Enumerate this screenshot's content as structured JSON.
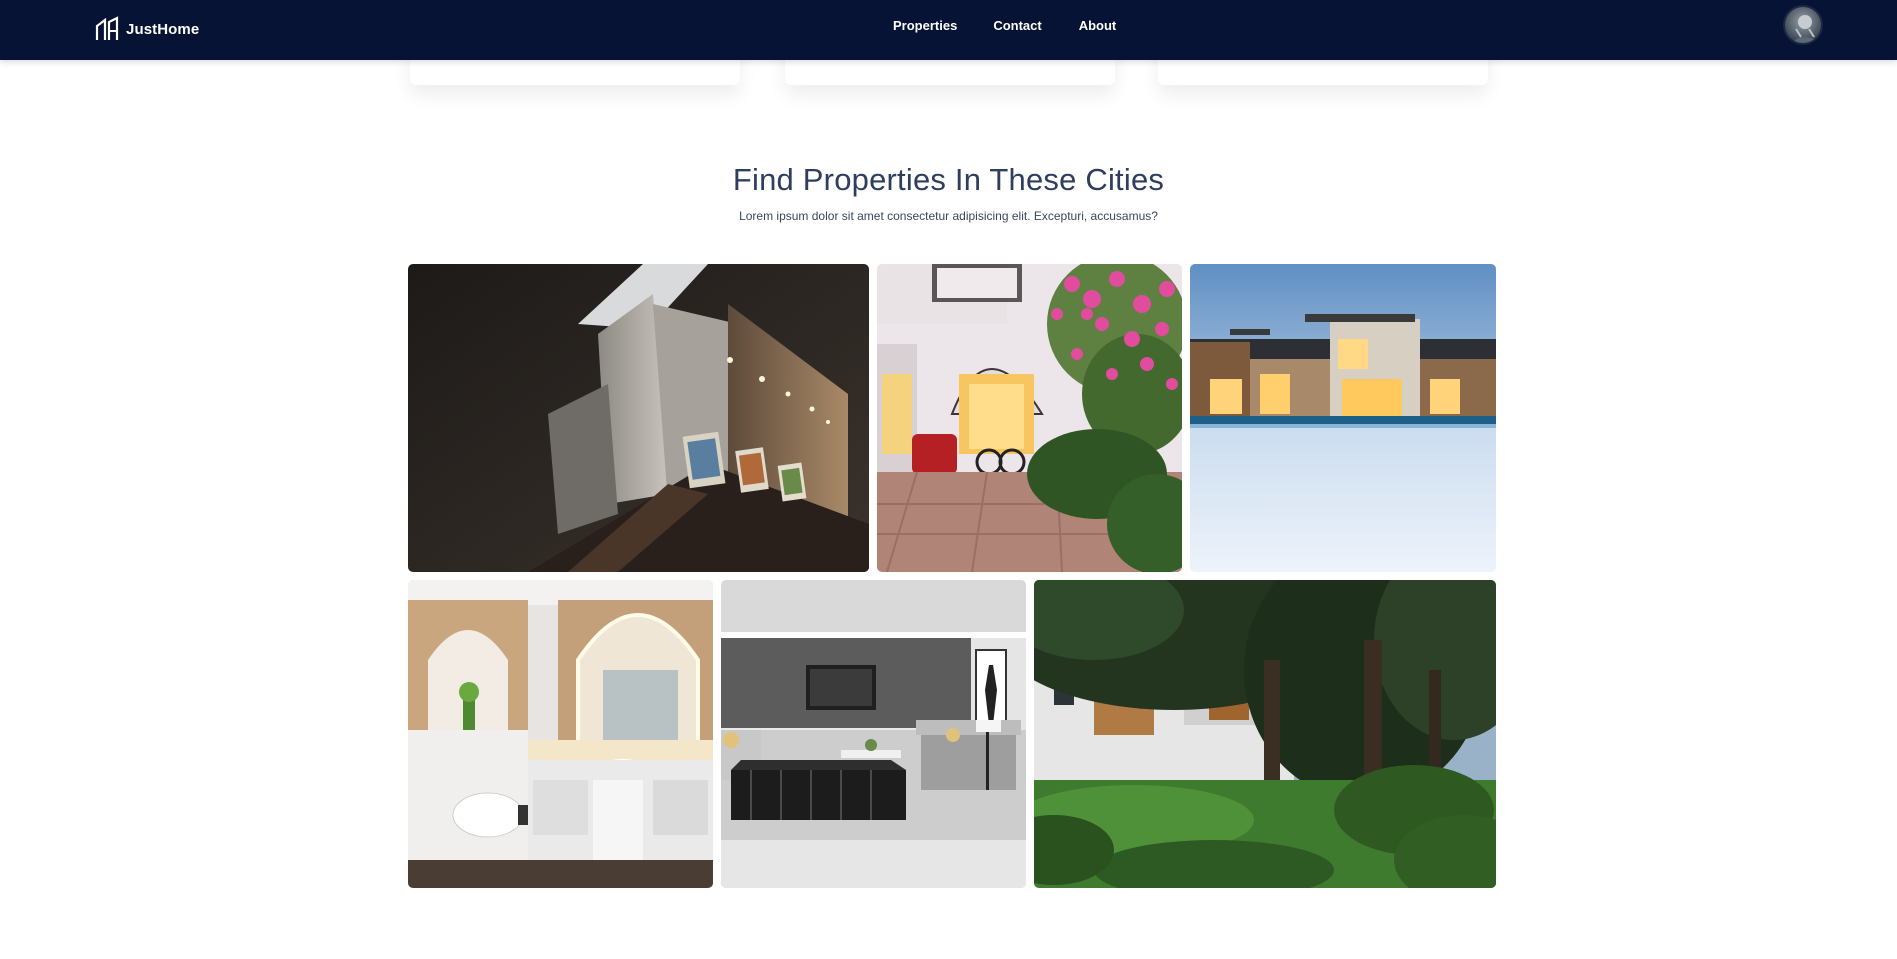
{
  "navbar": {
    "brand": "JustHome",
    "brand_icon": "house-outline-icon",
    "links": [
      "Properties",
      "Contact",
      "About"
    ],
    "avatar_icon": "user-avatar-icon"
  },
  "section": {
    "title": "Find Properties In These Cities",
    "subtitle": "Lorem ipsum dolor sit amet consectetur adipisicing elit. Excepturi, accusamus?"
  },
  "gallery": {
    "tiles": [
      {
        "name": "gallery-tile-gallery-interior"
      },
      {
        "name": "gallery-tile-flower-courtyard"
      },
      {
        "name": "gallery-tile-modern-house-snow"
      },
      {
        "name": "gallery-tile-bathroom"
      },
      {
        "name": "gallery-tile-living-room"
      },
      {
        "name": "gallery-tile-house-garden"
      }
    ]
  },
  "colors": {
    "navbar_bg": "#061334",
    "title": "#2f3e5c",
    "text": "#3a4660"
  }
}
